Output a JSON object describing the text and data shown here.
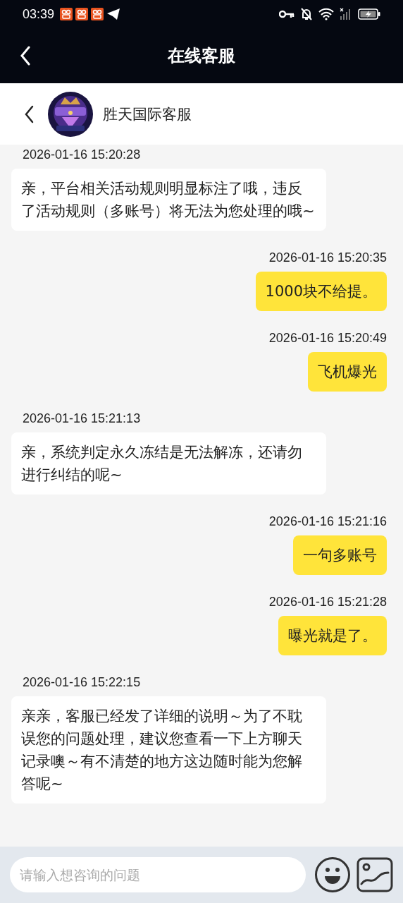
{
  "status_bar": {
    "time": "03:39",
    "notifications": [
      {
        "kind": "app"
      },
      {
        "kind": "app"
      },
      {
        "kind": "app"
      },
      {
        "kind": "plane"
      }
    ]
  },
  "title_bar": {
    "title": "在线客服"
  },
  "chat_header": {
    "name": "胜天国际客服"
  },
  "messages": [
    {
      "kind": "incoming",
      "time": "2026-01-16 15:20:28",
      "text": "亲，平台相关活动规则明显标注了哦，违反了活动规则（多账号）将无法为您处理的哦~"
    },
    {
      "kind": "outgoing",
      "time": "2026-01-16 15:20:35",
      "text": "1000块不给提。"
    },
    {
      "kind": "outgoing",
      "time": "2026-01-16 15:20:49",
      "text": "飞机爆光"
    },
    {
      "kind": "incoming",
      "time": "2026-01-16 15:21:13",
      "text": "亲，系统判定永久冻结是无法解冻，还请勿进行纠结的呢~"
    },
    {
      "kind": "outgoing",
      "time": "2026-01-16 15:21:16",
      "text": "一句多账号"
    },
    {
      "kind": "outgoing",
      "time": "2026-01-16 15:21:28",
      "text": "曝光就是了。"
    },
    {
      "kind": "incoming",
      "time": "2026-01-16 15:22:15",
      "text": "亲亲，客服已经发了详细的说明～为了不耽误您的问题处理，建议您查看一下上方聊天记录噢～有不清楚的地方这边随时能为您解答呢~"
    }
  ],
  "input_bar": {
    "placeholder": "请输入想咨询的问题"
  }
}
